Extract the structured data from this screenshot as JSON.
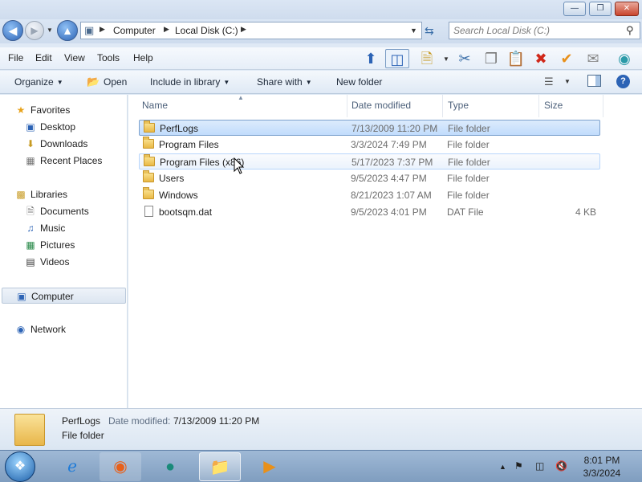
{
  "window": {
    "controls": {
      "minimize": "—",
      "maximize": "❐",
      "close": "✕"
    }
  },
  "address": {
    "crumbs": [
      "Computer",
      "Local Disk (C:)"
    ],
    "search_placeholder": "Search Local Disk (C:)"
  },
  "menu": {
    "items": [
      "File",
      "Edit",
      "View",
      "Tools",
      "Help"
    ]
  },
  "toolbar_icons": [
    "up-icon",
    "pane-icon",
    "properties-icon",
    "cut-icon",
    "copy-icon",
    "paste-icon",
    "delete-icon",
    "check-icon",
    "mail-icon",
    "globe-icon"
  ],
  "commands": {
    "organize": "Organize",
    "open": "Open",
    "include_in_library": "Include in library",
    "share_with": "Share with",
    "new_folder": "New folder"
  },
  "nav": {
    "favorites": "Favorites",
    "desktop": "Desktop",
    "downloads": "Downloads",
    "recent_places": "Recent Places",
    "libraries": "Libraries",
    "documents": "Documents",
    "music": "Music",
    "pictures": "Pictures",
    "videos": "Videos",
    "computer": "Computer",
    "network": "Network"
  },
  "columns": {
    "name": "Name",
    "date_modified": "Date modified",
    "type": "Type",
    "size": "Size"
  },
  "files": [
    {
      "name": "PerfLogs",
      "date": "7/13/2009 11:20 PM",
      "type": "File folder",
      "size": "",
      "kind": "folder"
    },
    {
      "name": "Program Files",
      "date": "3/3/2024 7:49 PM",
      "type": "File folder",
      "size": "",
      "kind": "folder"
    },
    {
      "name": "Program Files (x86)",
      "date": "5/17/2023 7:37 PM",
      "type": "File folder",
      "size": "",
      "kind": "folder"
    },
    {
      "name": "Users",
      "date": "9/5/2023 4:47 PM",
      "type": "File folder",
      "size": "",
      "kind": "folder"
    },
    {
      "name": "Windows",
      "date": "8/21/2023 1:07 AM",
      "type": "File folder",
      "size": "",
      "kind": "folder"
    },
    {
      "name": "bootsqm.dat",
      "date": "9/5/2023 4:01 PM",
      "type": "DAT File",
      "size": "4 KB",
      "kind": "file"
    }
  ],
  "details": {
    "name": "PerfLogs",
    "date_label": "Date modified:",
    "date_value": "7/13/2009 11:20 PM",
    "type": "File folder"
  },
  "taskbar": {
    "apps": [
      "internet-explorer-icon",
      "firefox-icon",
      "chat-app-icon",
      "file-explorer-icon",
      "media-player-icon"
    ],
    "clock_time": "8:01 PM",
    "clock_date": "3/3/2024"
  },
  "colors": {
    "selection": "#c1dcfc",
    "selection_border": "#7da2ce",
    "accent": "#2c63b5"
  }
}
